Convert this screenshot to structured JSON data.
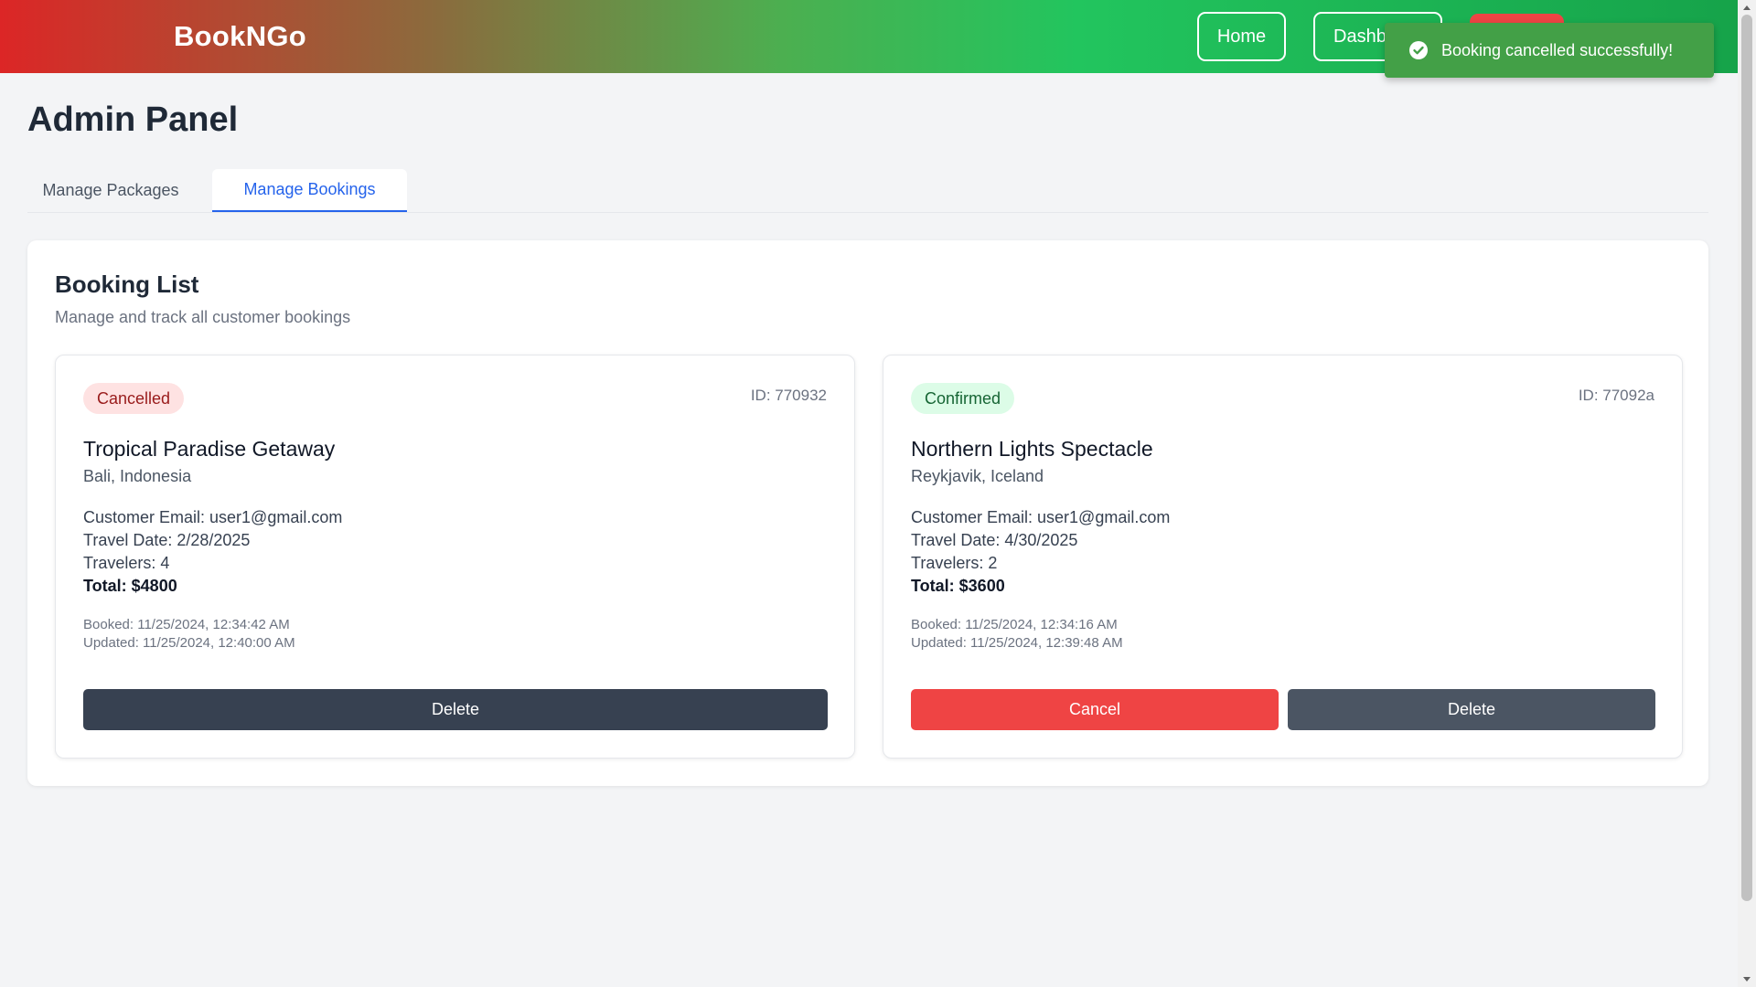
{
  "navbar": {
    "brand": "BookNGo",
    "home_label": "Home",
    "dashboard_label": "Dashb",
    "colors": {
      "start": "#dc2626",
      "mid": "#22c55e",
      "end": "#16a34a"
    }
  },
  "toast": {
    "icon": "check-circle-icon",
    "message": "Booking cancelled successfully!",
    "color": "#43a047"
  },
  "page": {
    "title": "Admin Panel",
    "tabs": [
      {
        "label": "Manage Packages",
        "active": false
      },
      {
        "label": "Manage Bookings",
        "active": true
      }
    ]
  },
  "booking_list": {
    "title": "Booking List",
    "subtitle": "Manage and track all customer bookings",
    "bookings": [
      {
        "status": "Cancelled",
        "id": "ID: 770932",
        "package": "Tropical Paradise Getaway",
        "location": "Bali, Indonesia",
        "email": "Customer Email: user1@gmail.com",
        "travel_date": "Travel Date: 2/28/2025",
        "travelers": "Travelers: 4",
        "total": "Total: $4800",
        "booked": "Booked: 11/25/2024, 12:34:42 AM",
        "updated": "Updated: 11/25/2024, 12:40:00 AM",
        "delete_label": "Delete"
      },
      {
        "status": "Confirmed",
        "id": "ID: 77092a",
        "package": "Northern Lights Spectacle",
        "location": "Reykjavik, Iceland",
        "email": "Customer Email: user1@gmail.com",
        "travel_date": "Travel Date: 4/30/2025",
        "travelers": "Travelers: 2",
        "total": "Total: $3600",
        "booked": "Booked: 11/25/2024, 12:34:16 AM",
        "updated": "Updated: 11/25/2024, 12:39:48 AM",
        "cancel_label": "Cancel",
        "delete_label": "Delete"
      }
    ]
  }
}
